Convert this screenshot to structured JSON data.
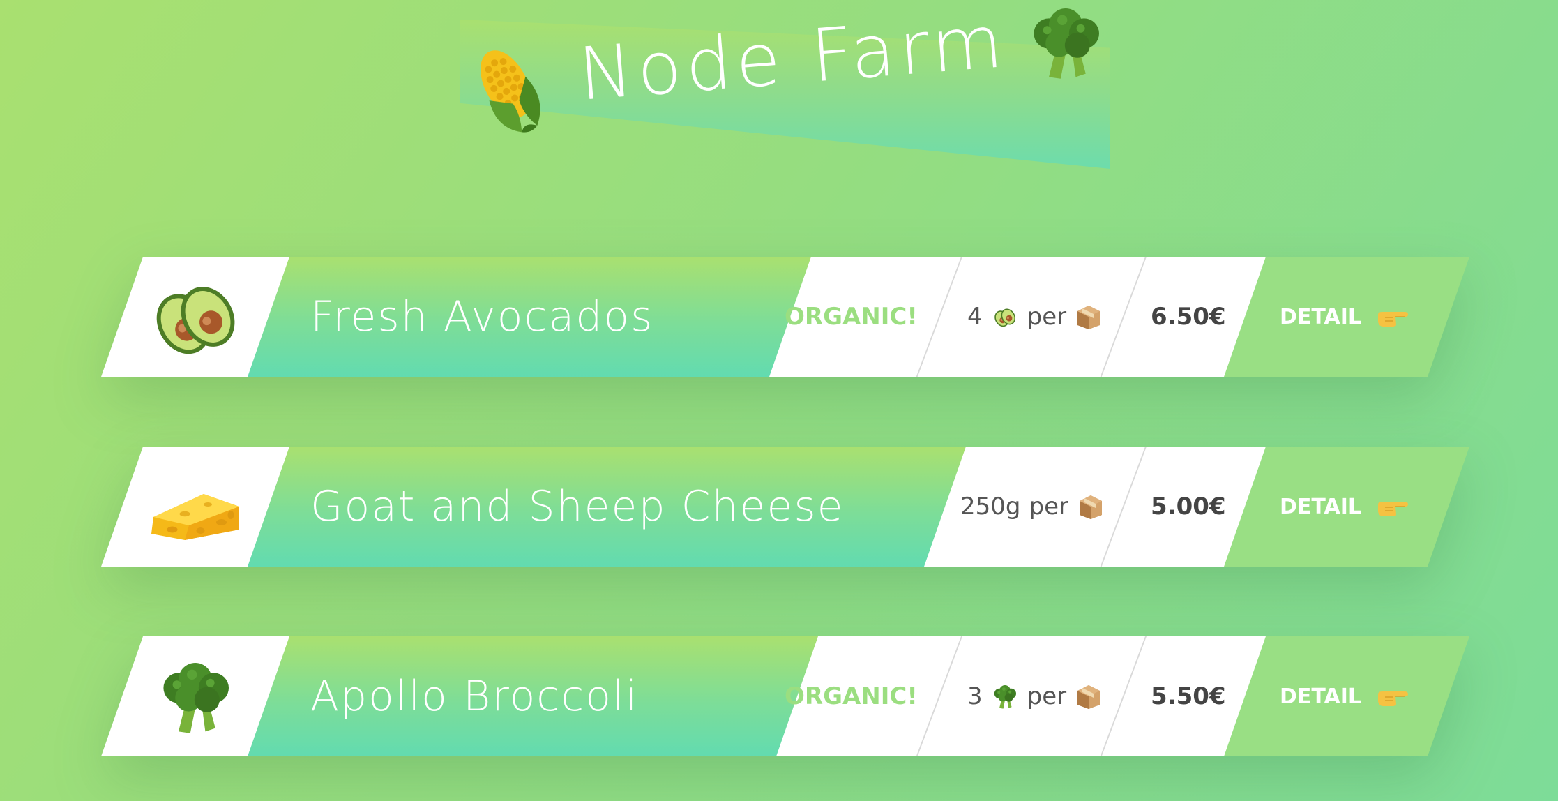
{
  "app": {
    "title": "Node Farm"
  },
  "products": [
    {
      "name": "Fresh Avocados",
      "emoji_icon": "avocado-icon",
      "organic": true,
      "organic_label": "ORGANIC!",
      "qty_amount": "4",
      "qty_icon": "avocado-icon",
      "qty_per": "per",
      "price": "6.50€",
      "detail_label": "DETAIL"
    },
    {
      "name": "Goat and Sheep Cheese",
      "emoji_icon": "cheese-icon",
      "organic": false,
      "organic_label": "",
      "qty_amount": "250g",
      "qty_icon": "",
      "qty_per": "per",
      "price": "5.00€",
      "detail_label": "DETAIL"
    },
    {
      "name": "Apollo Broccoli",
      "emoji_icon": "broccoli-icon",
      "organic": true,
      "organic_label": "ORGANIC!",
      "qty_amount": "3",
      "qty_icon": "broccoli-icon",
      "qty_per": "per",
      "price": "5.50€",
      "detail_label": "DETAIL"
    }
  ],
  "colors": {
    "background_from": "#a9e070",
    "background_to": "#7ddc98",
    "organic_green": "#9bde80",
    "detail_green": "#99df84",
    "price_text": "#444444"
  }
}
